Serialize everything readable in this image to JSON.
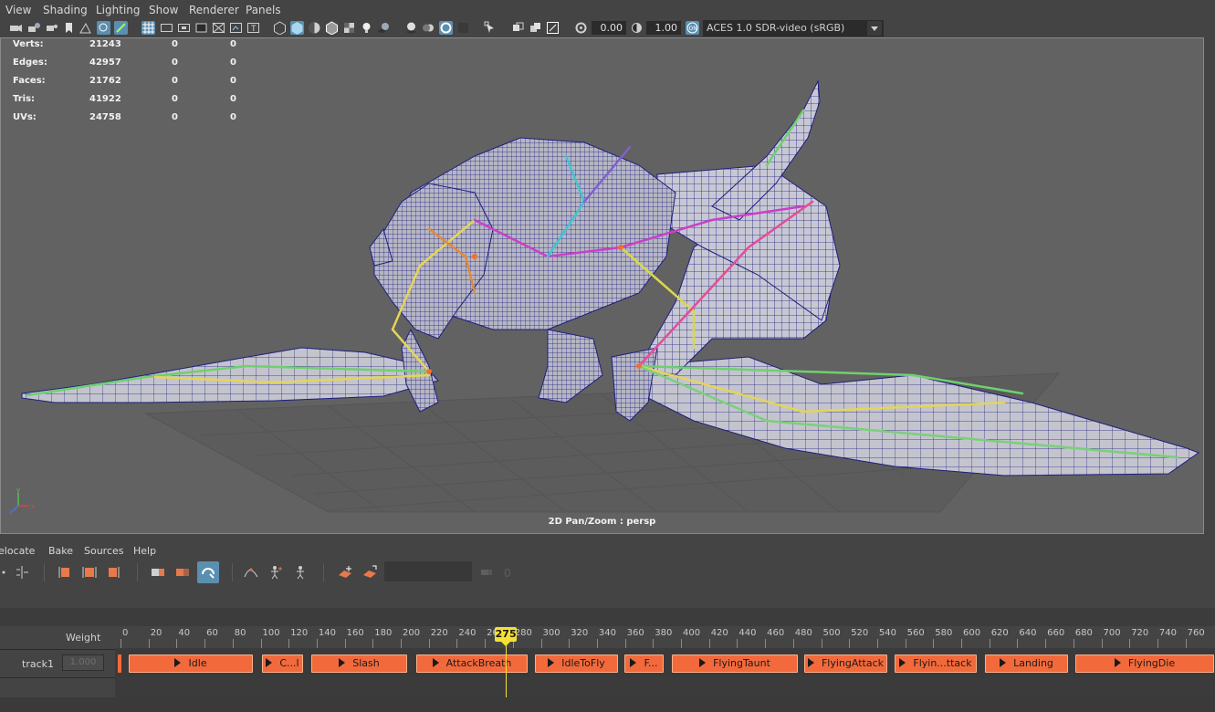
{
  "viewport_menu": [
    "View",
    "Shading",
    "Lighting",
    "Show",
    "Renderer",
    "Panels"
  ],
  "toolbar": {
    "gamma_value": "0.00",
    "exposure_value": "1.00",
    "color_space": "ACES 1.0 SDR-video (sRGB)"
  },
  "hud": [
    {
      "label": "Verts:",
      "total": "21243",
      "selected": "0",
      "uv": "0"
    },
    {
      "label": "Edges:",
      "total": "42957",
      "selected": "0",
      "uv": "0"
    },
    {
      "label": "Faces:",
      "total": "21762",
      "selected": "0",
      "uv": "0"
    },
    {
      "label": "Tris:",
      "total": "41922",
      "selected": "0",
      "uv": "0"
    },
    {
      "label": "UVs:",
      "total": "24758",
      "selected": "0",
      "uv": "0"
    }
  ],
  "camera_label": "2D Pan/Zoom : persp",
  "trax_menu": [
    "elocate",
    "Bake",
    "Sources",
    "Help"
  ],
  "trax": {
    "weight_label": "Weight",
    "track_name": "track1",
    "track_weight": "1.000",
    "current_frame": "275",
    "ruler_labels": [
      "0",
      "20",
      "40",
      "60",
      "80",
      "100",
      "120",
      "140",
      "160",
      "180",
      "200",
      "220",
      "240",
      "260",
      "280",
      "300",
      "320",
      "340",
      "360",
      "380",
      "400",
      "420",
      "440",
      "460",
      "480",
      "500",
      "520",
      "540",
      "560",
      "580",
      "600",
      "620",
      "640",
      "660",
      "680",
      "700",
      "720",
      "740",
      "760"
    ],
    "clips": [
      "Idle",
      "C...l",
      "Slash",
      "AttackBreath",
      "IdleToFly",
      "F...",
      "FlyingTaunt",
      "FlyingAttack",
      "Flyin...ttack",
      "Landing",
      "FlyingDie"
    ]
  },
  "colors": {
    "clip": "#f26a3c",
    "playhead": "#f5e033",
    "active_button": "#5b8fb0",
    "viewport_bg": "#626262",
    "mesh_wire": "#1e1e80"
  }
}
